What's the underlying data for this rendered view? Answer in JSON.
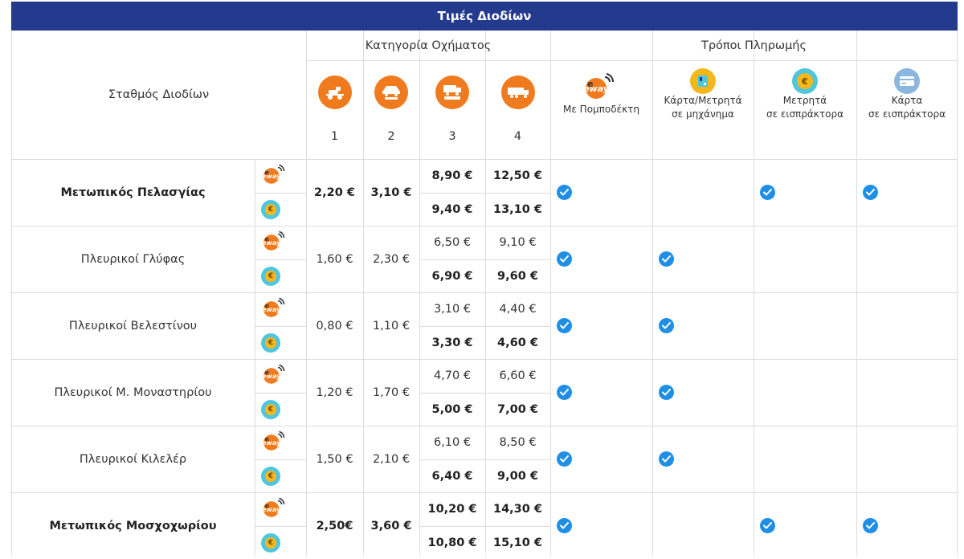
{
  "title": "Τιμές Διοδίων",
  "header": {
    "station_col": "Σταθμός Διοδίων",
    "vehicle_group": "Κατηγορία Οχήματος",
    "payment_group": "Τρόποι Πληρωμής",
    "vehicle_categories": [
      "1",
      "2",
      "3",
      "4"
    ],
    "payment_methods": [
      {
        "label_line1": "Με Πομποδέκτη",
        "label_line2": "",
        "icon": "eway-transponder-icon"
      },
      {
        "label_line1": "Κάρτα/Μετρητά",
        "label_line2": "σε μηχάνημα",
        "icon": "card-cash-machine-icon"
      },
      {
        "label_line1": "Μετρητά",
        "label_line2": "σε εισπράκτορα",
        "icon": "euro-coin-icon"
      },
      {
        "label_line1": "Κάρτα",
        "label_line2": "σε εισπράκτορα",
        "icon": "credit-card-icon"
      }
    ],
    "eway_logo_text": "eway"
  },
  "colors": {
    "title_bar": "#243a8c",
    "vehicle_icon": "#f07a1e",
    "check": "#1f8fe5",
    "coin_ring": "#4fc6de",
    "coin": "#f4b81c"
  },
  "rows": [
    {
      "name": "Μετωπικός Πελασγίας",
      "bold": true,
      "p1": "2,20 €",
      "p2": "3,10 €",
      "p3a": "8,90 €",
      "p3b": "9,40 €",
      "p4a": "12,50 €",
      "p4b": "13,10 €",
      "pay": [
        true,
        false,
        true,
        true
      ]
    },
    {
      "name": "Πλευρικοί Γλύφας",
      "bold": false,
      "p1": "1,60 €",
      "p2": "2,30 €",
      "p3a": "6,50 €",
      "p3b": "6,90 €",
      "p4a": "9,10 €",
      "p4b": "9,60 €",
      "pay": [
        true,
        true,
        false,
        false
      ]
    },
    {
      "name": "Πλευρικοί Βελεστίνου",
      "bold": false,
      "p1": "0,80 €",
      "p2": "1,10 €",
      "p3a": "3,10 €",
      "p3b": "3,30 €",
      "p4a": "4,40 €",
      "p4b": "4,60 €",
      "pay": [
        true,
        true,
        false,
        false
      ]
    },
    {
      "name": "Πλευρικοί Μ. Μοναστηρίου",
      "bold": false,
      "p1": "1,20 €",
      "p2": "1,70 €",
      "p3a": "4,70 €",
      "p3b": "5,00 €",
      "p4a": "6,60 €",
      "p4b": "7,00 €",
      "pay": [
        true,
        true,
        false,
        false
      ]
    },
    {
      "name": "Πλευρικοί Κιλελέρ",
      "bold": false,
      "p1": "1,50 €",
      "p2": "2,10 €",
      "p3a": "6,10 €",
      "p3b": "6,40 €",
      "p4a": "8,50 €",
      "p4b": "9,00 €",
      "pay": [
        true,
        true,
        false,
        false
      ]
    },
    {
      "name": "Μετωπικός Μοσχοχωρίου",
      "bold": true,
      "p1": "2,50€",
      "p2": "3,60 €",
      "p3a": "10,20 €",
      "p3b": "10,80 €",
      "p4a": "14,30 €",
      "p4b": "15,10 €",
      "pay": [
        true,
        false,
        true,
        true
      ]
    }
  ]
}
